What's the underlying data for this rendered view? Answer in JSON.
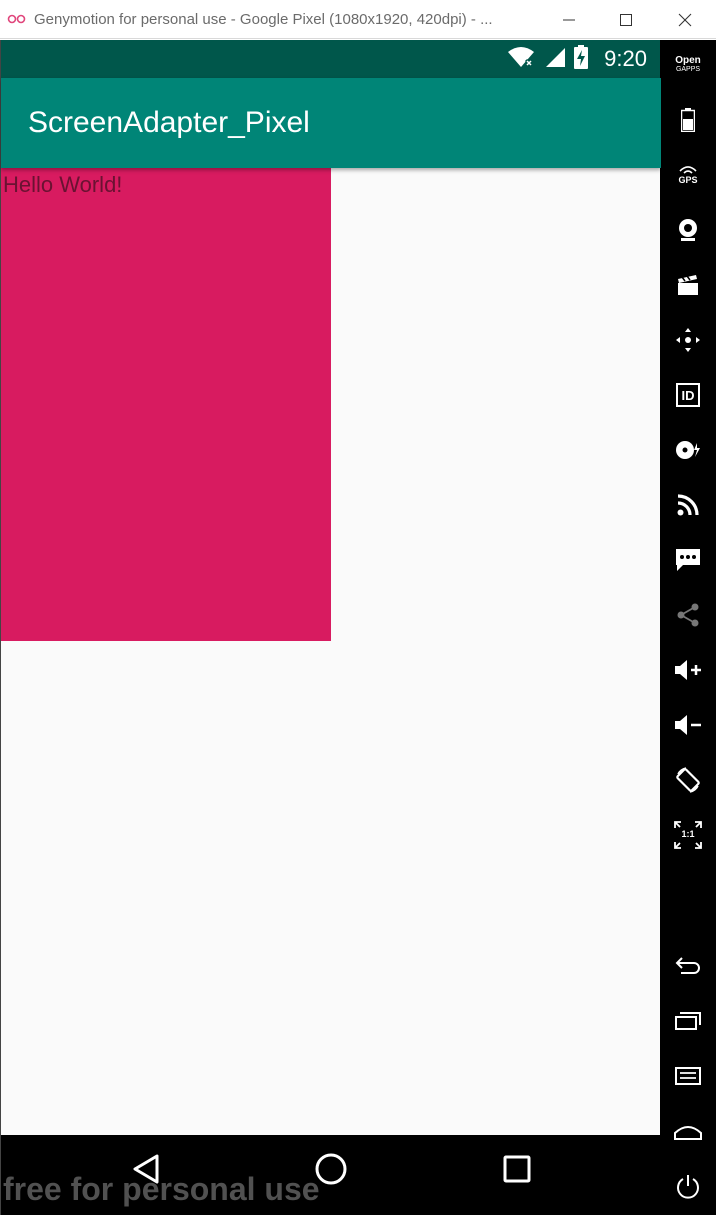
{
  "window": {
    "title": "Genymotion for personal use - Google Pixel (1080x1920, 420dpi) - ...",
    "controls": [
      "minimize",
      "maximize",
      "close"
    ]
  },
  "status_bar": {
    "time": "9:20",
    "icons": [
      "wifi-icon",
      "signal-icon",
      "battery-charging-icon"
    ],
    "color": "#00574b"
  },
  "app_bar": {
    "title": "ScreenAdapter_Pixel",
    "color": "#008577"
  },
  "content": {
    "text": "Hello World!",
    "box_color": "#d81b60",
    "background": "#fafafa"
  },
  "nav_bar": {
    "buttons": [
      "back",
      "home",
      "recents"
    ]
  },
  "watermark": "free for personal use",
  "sidebar": {
    "opengapps_top": "Open",
    "opengapps_bottom": "GAPPS",
    "gps_label": "GPS",
    "id_label": "ID",
    "pixel_perfect_label": "1:1",
    "tools": [
      "open-gapps",
      "battery",
      "gps",
      "webcam",
      "capture",
      "remote-control",
      "identifiers",
      "disk-io",
      "network",
      "sms",
      "share",
      "volume-up",
      "volume-down",
      "rotate",
      "pixel-perfect",
      "back",
      "recent-apps",
      "menu",
      "home",
      "power"
    ]
  }
}
